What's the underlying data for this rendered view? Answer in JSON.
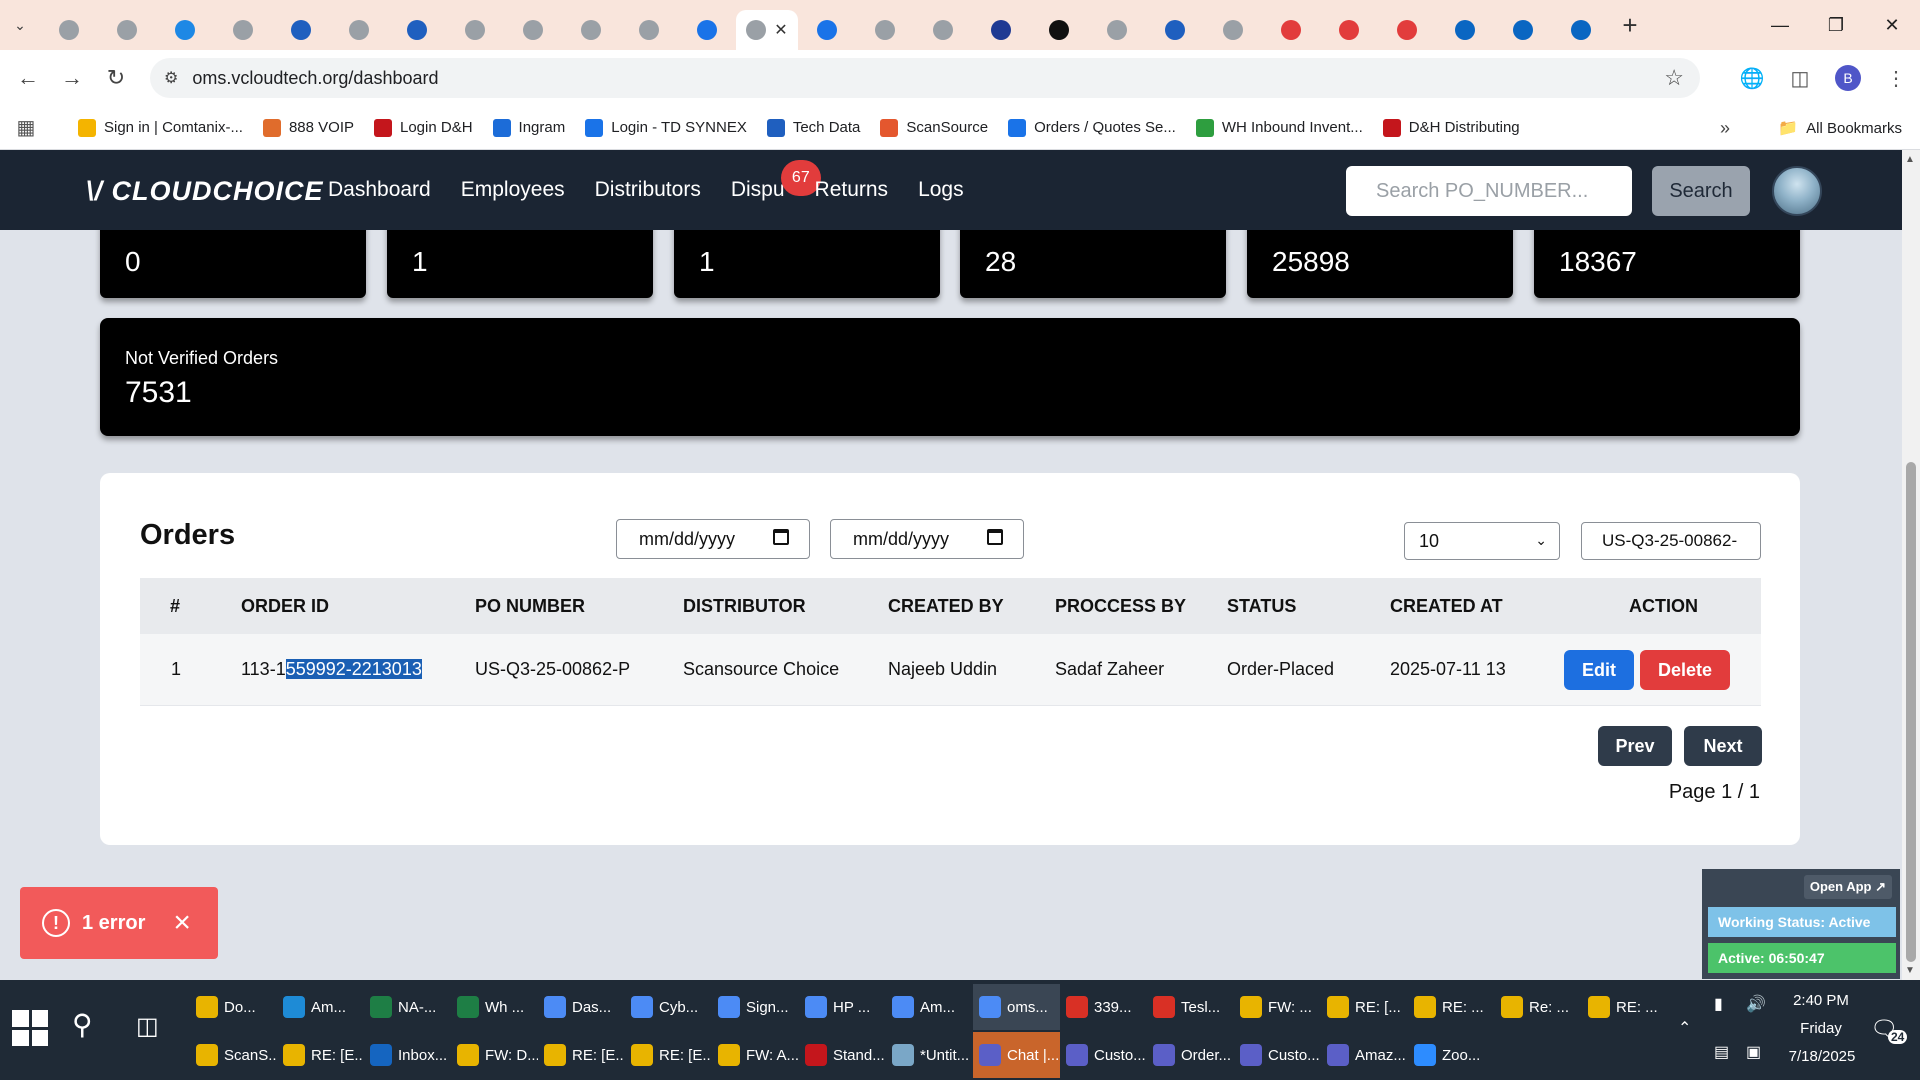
{
  "browser": {
    "url": "oms.vcloudtech.org/dashboard",
    "bookmarks": [
      {
        "label": "Sign in | Comtanix-...",
        "color": "#f4b400"
      },
      {
        "label": "888 VOIP",
        "color": "#e06c2c"
      },
      {
        "label": "Login D&H",
        "color": "#c4161c"
      },
      {
        "label": "Ingram",
        "color": "#1c6cd8"
      },
      {
        "label": "Login - TD SYNNEX",
        "color": "#1a73e8"
      },
      {
        "label": "Tech Data",
        "color": "#1f5fbf"
      },
      {
        "label": "ScanSource",
        "color": "#e4572e"
      },
      {
        "label": "Orders / Quotes Se...",
        "color": "#1a73e8"
      },
      {
        "label": "WH Inbound Invent...",
        "color": "#2e9e3f"
      },
      {
        "label": "D&H Distributing",
        "color": "#c4161c"
      }
    ],
    "all_bookmarks": "All Bookmarks",
    "profile_initial": "B"
  },
  "app": {
    "logo": "\\/ CLOUDCHOICE",
    "nav": {
      "dashboard": "Dashboard",
      "employees": "Employees",
      "distributors": "Distributors",
      "disputes": "Dispu",
      "disputes_badge": "67",
      "returns": "Returns",
      "logs": "Logs"
    },
    "search_placeholder": "Search PO_NUMBER...",
    "search_button": "Search"
  },
  "stats": {
    "values": [
      "0",
      "1",
      "1",
      "28",
      "25898",
      "18367"
    ],
    "not_verified_label": "Not Verified Orders",
    "not_verified_value": "7531"
  },
  "orders": {
    "title": "Orders",
    "date_from_placeholder": "mm/dd/yyyy",
    "date_to_placeholder": "mm/dd/yyyy",
    "per_page": "10",
    "po_filter_value": "US-Q3-25-00862-",
    "columns": [
      "#",
      "ORDER ID",
      "PO NUMBER",
      "DISTRIBUTOR",
      "CREATED BY",
      "PROCCESS BY",
      "STATUS",
      "CREATED AT",
      "ACTION"
    ],
    "rows": [
      {
        "num": "1",
        "order_id_prefix": "113-1",
        "order_id_selected": "559992-2213013",
        "po_number": "US-Q3-25-00862-P",
        "distributor": "Scansource Choice",
        "created_by": "Najeeb Uddin",
        "processed_by": "Sadaf Zaheer",
        "status": "Order-Placed",
        "created_at": "2025-07-11 13",
        "edit": "Edit",
        "delete": "Delete"
      }
    ],
    "prev": "Prev",
    "next": "Next",
    "page": "Page 1 / 1"
  },
  "toast": {
    "text": "1 error"
  },
  "status_widget": {
    "open_app": "Open App ↗",
    "working_status": "Working Status: Active",
    "active_time": "Active: 06:50:47"
  },
  "taskbar": {
    "row1": [
      {
        "label": "Do...",
        "color": "#e8b400",
        "icon": "folder-icon"
      },
      {
        "label": "Am...",
        "color": "#1e8bd6",
        "icon": "edge-icon"
      },
      {
        "label": "NA-...",
        "color": "#1e7e45",
        "icon": "excel-icon"
      },
      {
        "label": "Wh ...",
        "color": "#1e7e45",
        "icon": "excel-icon"
      },
      {
        "label": "Das...",
        "color": "#4c8bf5",
        "icon": "chrome-icon"
      },
      {
        "label": "Cyb...",
        "color": "#4c8bf5",
        "icon": "chrome-icon"
      },
      {
        "label": "Sign...",
        "color": "#4c8bf5",
        "icon": "chrome-icon"
      },
      {
        "label": "HP ...",
        "color": "#4c8bf5",
        "icon": "chrome-icon"
      },
      {
        "label": "Am...",
        "color": "#4c8bf5",
        "icon": "chrome-icon"
      },
      {
        "label": "oms...",
        "color": "#4c8bf5",
        "icon": "chrome-icon",
        "active": true
      },
      {
        "label": "339...",
        "color": "#d93025",
        "icon": "chrome-icon"
      },
      {
        "label": "Tesl...",
        "color": "#d93025",
        "icon": "chrome-icon"
      },
      {
        "label": "FW: ...",
        "color": "#e8b400",
        "icon": "mail-icon"
      },
      {
        "label": "RE: [...",
        "color": "#e8b400",
        "icon": "mail-icon"
      },
      {
        "label": "RE: ...",
        "color": "#e8b400",
        "icon": "mail-icon"
      },
      {
        "label": "Re: ...",
        "color": "#e8b400",
        "icon": "mail-icon"
      },
      {
        "label": "RE: ...",
        "color": "#e8b400",
        "icon": "mail-icon"
      }
    ],
    "row2": [
      {
        "label": "ScanS...",
        "color": "#e8b400",
        "icon": "mail-icon"
      },
      {
        "label": "RE: [E...",
        "color": "#e8b400",
        "icon": "mail-icon"
      },
      {
        "label": "Inbox...",
        "color": "#1565c0",
        "icon": "outlook-icon"
      },
      {
        "label": "FW: D...",
        "color": "#e8b400",
        "icon": "mail-icon"
      },
      {
        "label": "RE: [E...",
        "color": "#e8b400",
        "icon": "mail-icon"
      },
      {
        "label": "RE: [E...",
        "color": "#e8b400",
        "icon": "mail-icon"
      },
      {
        "label": "FW: A...",
        "color": "#e8b400",
        "icon": "mail-icon"
      },
      {
        "label": "Stand...",
        "color": "#c4161c",
        "icon": "pdf-icon"
      },
      {
        "label": "*Untit...",
        "color": "#7aa7c7",
        "icon": "notepad-icon"
      },
      {
        "label": "Chat |...",
        "color": "#5b5fc7",
        "icon": "teams-icon",
        "orange": true
      },
      {
        "label": "Custo...",
        "color": "#5b5fc7",
        "icon": "teams-icon"
      },
      {
        "label": "Order...",
        "color": "#5b5fc7",
        "icon": "teams-icon"
      },
      {
        "label": "Custo...",
        "color": "#5b5fc7",
        "icon": "teams-icon"
      },
      {
        "label": "Amaz...",
        "color": "#5b5fc7",
        "icon": "teams-icon"
      },
      {
        "label": "Zoo...",
        "color": "#2d8cff",
        "icon": "zoom-icon"
      }
    ],
    "time": "2:40 PM",
    "day": "Friday",
    "date": "7/18/2025",
    "notification_count": "24"
  }
}
